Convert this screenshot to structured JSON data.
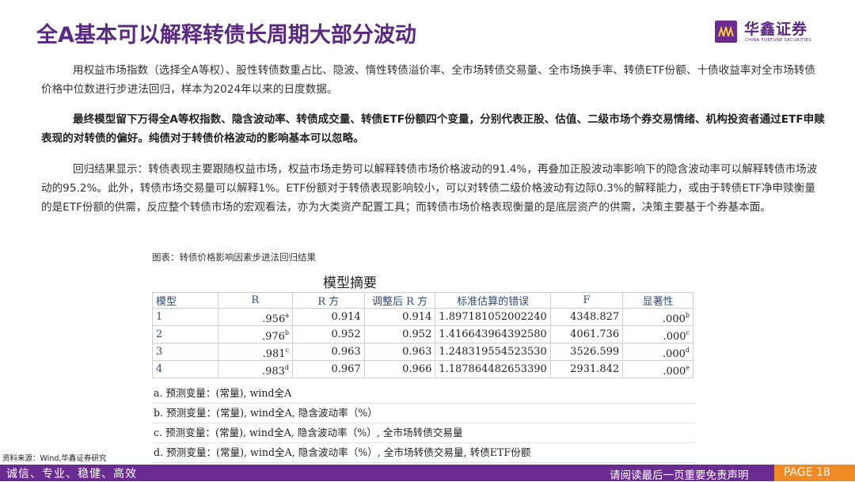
{
  "header": {
    "title": "全A基本可以解释转债长周期大部分波动",
    "logo": {
      "cn": "华鑫证券",
      "en": "CHINA FORTUNE SECURITIES",
      "icon": "hx-logo-icon"
    }
  },
  "body": {
    "p1": "用权益市场指数（选择全A等权）、股性转债数重占比、隐波、惰性转债溢价率、全市场转债交易量、全市场换手率、转债ETF份额、十债收益率对全市场转债价格中位数进行步进法回归，样本为2024年以来的日度数据。",
    "p2": "最终模型留下万得全A等权指数、隐含波动率、转债成交量、转债ETF份额四个变量，分别代表正股、估值、二级市场个券交易情绪、机构投资者通过ETF申赎表现的对转债的偏好。纯债对于转债价格波动的影响基本可以忽略。",
    "p3": "回归结果显示：转债表现主要跟随权益市场，权益市场走势可以解释转债市场价格波动的91.4%，再叠加正股波动率影响下的隐含波动率可以解释转债市场波动的95.2%。此外，转债市场交易量可以解释1%。ETF份额对于转债表现影响较小，可以对转债二级价格波动有边际0.3%的解释能力，或由于转债ETF净申赎衡量的是ETF份额的供需，反应整个转债市场的宏观看法，亦为大类资产配置工具；而转债市场价格表现衡量的是底层资产的供需，决策主要基于个券基本面。"
  },
  "figure": {
    "caption": "图表：转债价格影响因素步进法回归结果",
    "table_title": "模型摘要",
    "columns": [
      "模型",
      "R",
      "R 方",
      "调整后 R 方",
      "标准估算的错误",
      "F",
      "显著性"
    ],
    "rows": [
      {
        "model": "1",
        "r": ".956",
        "r_sup": "a",
        "r2": "0.914",
        "adj": "0.914",
        "se": "1.897181052002240",
        "f": "4348.827",
        "sig": ".000",
        "sig_sup": "b"
      },
      {
        "model": "2",
        "r": ".976",
        "r_sup": "b",
        "r2": "0.952",
        "adj": "0.952",
        "se": "1.416643964392580",
        "f": "4061.736",
        "sig": ".000",
        "sig_sup": "c"
      },
      {
        "model": "3",
        "r": ".981",
        "r_sup": "c",
        "r2": "0.963",
        "adj": "0.963",
        "se": "1.248319554523530",
        "f": "3526.599",
        "sig": ".000",
        "sig_sup": "d"
      },
      {
        "model": "4",
        "r": ".983",
        "r_sup": "d",
        "r2": "0.967",
        "adj": "0.966",
        "se": "1.187864482653390",
        "f": "2931.842",
        "sig": ".000",
        "sig_sup": "e"
      }
    ],
    "notes": [
      "a. 预测变量：(常量), wind全A",
      "b. 预测变量：(常量), wind全A, 隐含波动率（%）",
      "c. 预测变量：(常量), wind全A, 隐含波动率（%）, 全市场转债交易量",
      "d. 预测变量：(常量), wind全A, 隐含波动率（%）, 全市场转债交易量, 转债ETF份额"
    ]
  },
  "source": "资料来源：Wind,华鑫证券研究",
  "footer": {
    "slogan": "诚信、专业、稳健、高效",
    "disclaimer": "请阅读最后一页重要免责声明",
    "page": "PAGE 18"
  },
  "colors": {
    "brand_purple": "#6b2c91",
    "page_orange": "#f08a24",
    "table_header_blue": "#2e4b7a"
  }
}
